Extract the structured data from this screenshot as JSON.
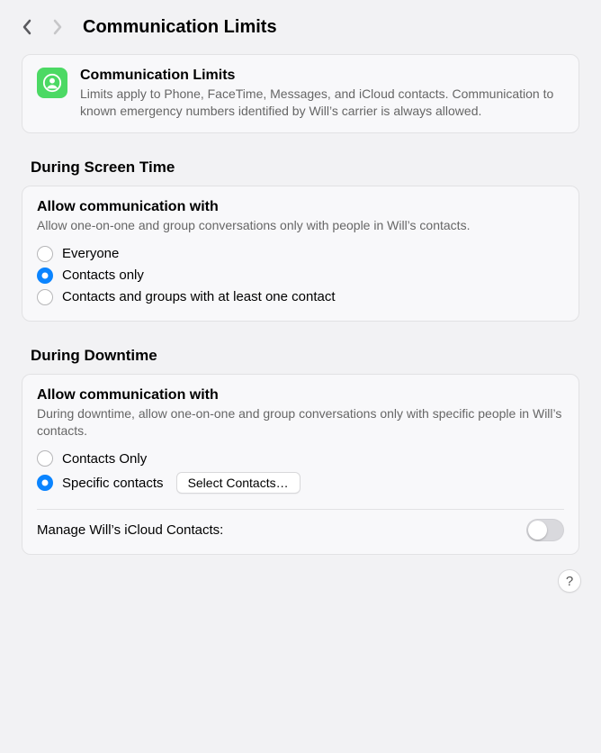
{
  "header": {
    "title": "Communication Limits"
  },
  "info": {
    "title": "Communication Limits",
    "desc": "Limits apply to Phone, FaceTime, Messages, and iCloud contacts. Communication to known emergency numbers identified by Will’s carrier is always allowed."
  },
  "sections": {
    "screenTime": {
      "heading": "During Screen Time",
      "subHeading": "Allow communication with",
      "subDesc": "Allow one-on-one and group conversations only with people in Will’s contacts.",
      "options": [
        {
          "label": "Everyone",
          "checked": false
        },
        {
          "label": "Contacts only",
          "checked": true
        },
        {
          "label": "Contacts and groups with at least one contact",
          "checked": false
        }
      ]
    },
    "downtime": {
      "heading": "During Downtime",
      "subHeading": "Allow communication with",
      "subDesc": "During downtime, allow one-on-one and group conversations only with specific people in Will’s contacts.",
      "options": [
        {
          "label": "Contacts Only",
          "checked": false
        },
        {
          "label": "Specific contacts",
          "checked": true
        }
      ],
      "selectBtn": "Select Contacts…",
      "manageLabel": "Manage Will’s iCloud Contacts:"
    }
  },
  "help": "?"
}
